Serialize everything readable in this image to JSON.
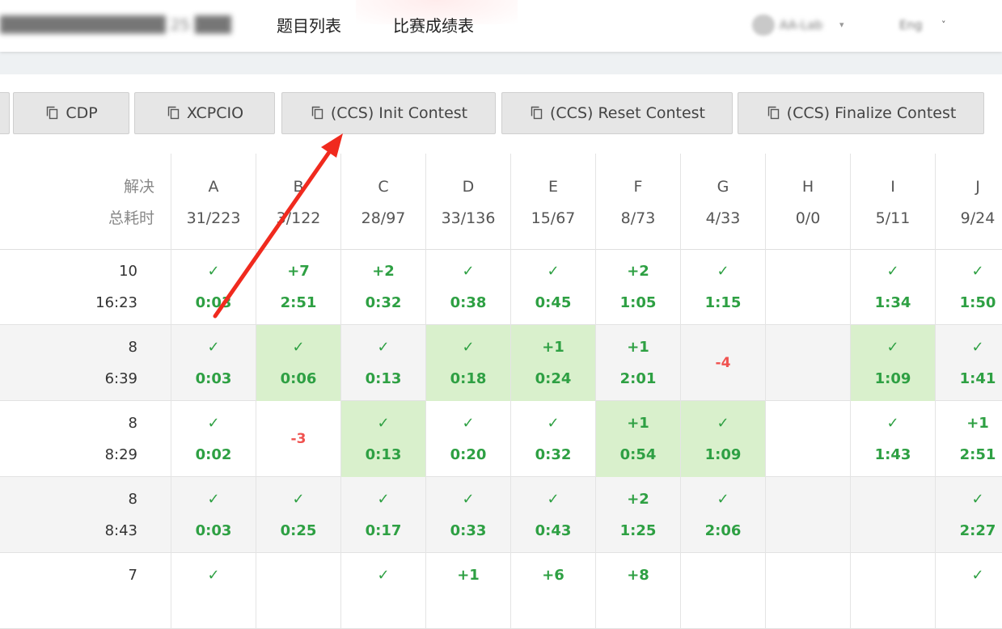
{
  "nav": {
    "contest_title": "██████████████ 25 ███████",
    "links": [
      "题目列表",
      "比赛成绩表"
    ],
    "user_name": "AA-Lab",
    "user_caret": "▾",
    "lang": "Eng",
    "lang_caret": "˅"
  },
  "toolbar": {
    "buttons": [
      "CDP",
      "XCPCIO",
      "(CCS) Init Contest",
      "(CCS) Reset Contest",
      "(CCS) Finalize Contest"
    ]
  },
  "scoreboard": {
    "header_label_1": "解决",
    "header_label_2": "总耗时",
    "problems": [
      {
        "letter": "A",
        "stat": "31/223"
      },
      {
        "letter": "B",
        "stat": "3/122"
      },
      {
        "letter": "C",
        "stat": "28/97"
      },
      {
        "letter": "D",
        "stat": "33/136"
      },
      {
        "letter": "E",
        "stat": "15/67"
      },
      {
        "letter": "F",
        "stat": "8/73"
      },
      {
        "letter": "G",
        "stat": "4/33"
      },
      {
        "letter": "H",
        "stat": "0/0"
      },
      {
        "letter": "I",
        "stat": "5/11"
      },
      {
        "letter": "J",
        "stat": "9/24"
      }
    ],
    "rows": [
      {
        "solved": "10",
        "time": "16:23",
        "cells": [
          {
            "top": "✓",
            "bot": "0:03",
            "first": false
          },
          {
            "top": "+7",
            "bot": "2:51",
            "first": false
          },
          {
            "top": "+2",
            "bot": "0:32",
            "first": false
          },
          {
            "top": "✓",
            "bot": "0:38",
            "first": false
          },
          {
            "top": "✓",
            "bot": "0:45",
            "first": false
          },
          {
            "top": "+2",
            "bot": "1:05",
            "first": false
          },
          {
            "top": "✓",
            "bot": "1:15",
            "first": false
          },
          null,
          {
            "top": "✓",
            "bot": "1:34",
            "first": false
          },
          {
            "top": "✓",
            "bot": "1:50",
            "first": false
          }
        ]
      },
      {
        "solved": "8",
        "time": "6:39",
        "cells": [
          {
            "top": "✓",
            "bot": "0:03",
            "first": false
          },
          {
            "top": "✓",
            "bot": "0:06",
            "first": true
          },
          {
            "top": "✓",
            "bot": "0:13",
            "first": false
          },
          {
            "top": "✓",
            "bot": "0:18",
            "first": true
          },
          {
            "top": "+1",
            "bot": "0:24",
            "first": true
          },
          {
            "top": "+1",
            "bot": "2:01",
            "first": false
          },
          {
            "fail": "-4"
          },
          null,
          {
            "top": "✓",
            "bot": "1:09",
            "first": true
          },
          {
            "top": "✓",
            "bot": "1:41",
            "first": false
          }
        ]
      },
      {
        "solved": "8",
        "time": "8:29",
        "cells": [
          {
            "top": "✓",
            "bot": "0:02",
            "first": false
          },
          {
            "fail": "-3"
          },
          {
            "top": "✓",
            "bot": "0:13",
            "first": true
          },
          {
            "top": "✓",
            "bot": "0:20",
            "first": false
          },
          {
            "top": "✓",
            "bot": "0:32",
            "first": false
          },
          {
            "top": "+1",
            "bot": "0:54",
            "first": true
          },
          {
            "top": "✓",
            "bot": "1:09",
            "first": true
          },
          null,
          {
            "top": "✓",
            "bot": "1:43",
            "first": false
          },
          {
            "top": "+1",
            "bot": "2:51",
            "first": false
          }
        ]
      },
      {
        "solved": "8",
        "time": "8:43",
        "cells": [
          {
            "top": "✓",
            "bot": "0:03",
            "first": false
          },
          {
            "top": "✓",
            "bot": "0:25",
            "first": false
          },
          {
            "top": "✓",
            "bot": "0:17",
            "first": false
          },
          {
            "top": "✓",
            "bot": "0:33",
            "first": false
          },
          {
            "top": "✓",
            "bot": "0:43",
            "first": false
          },
          {
            "top": "+2",
            "bot": "1:25",
            "first": false
          },
          {
            "top": "✓",
            "bot": "2:06",
            "first": false
          },
          null,
          null,
          {
            "top": "✓",
            "bot": "2:27",
            "first": false
          }
        ]
      },
      {
        "solved": "7",
        "time": "",
        "cells": [
          {
            "top": "✓",
            "bot": "",
            "first": false
          },
          null,
          {
            "top": "✓",
            "bot": "",
            "first": false
          },
          {
            "top": "+1",
            "bot": "",
            "first": false
          },
          {
            "top": "+6",
            "bot": "",
            "first": false
          },
          {
            "top": "+8",
            "bot": "",
            "first": false
          },
          null,
          null,
          null,
          {
            "top": "✓",
            "bot": "",
            "first": false
          }
        ]
      }
    ]
  },
  "colors": {
    "accepted": "#2ea043",
    "failed": "#f0524f",
    "first_blood_bg": "#d9f0cc",
    "annotation_arrow": "#f02a1e"
  }
}
